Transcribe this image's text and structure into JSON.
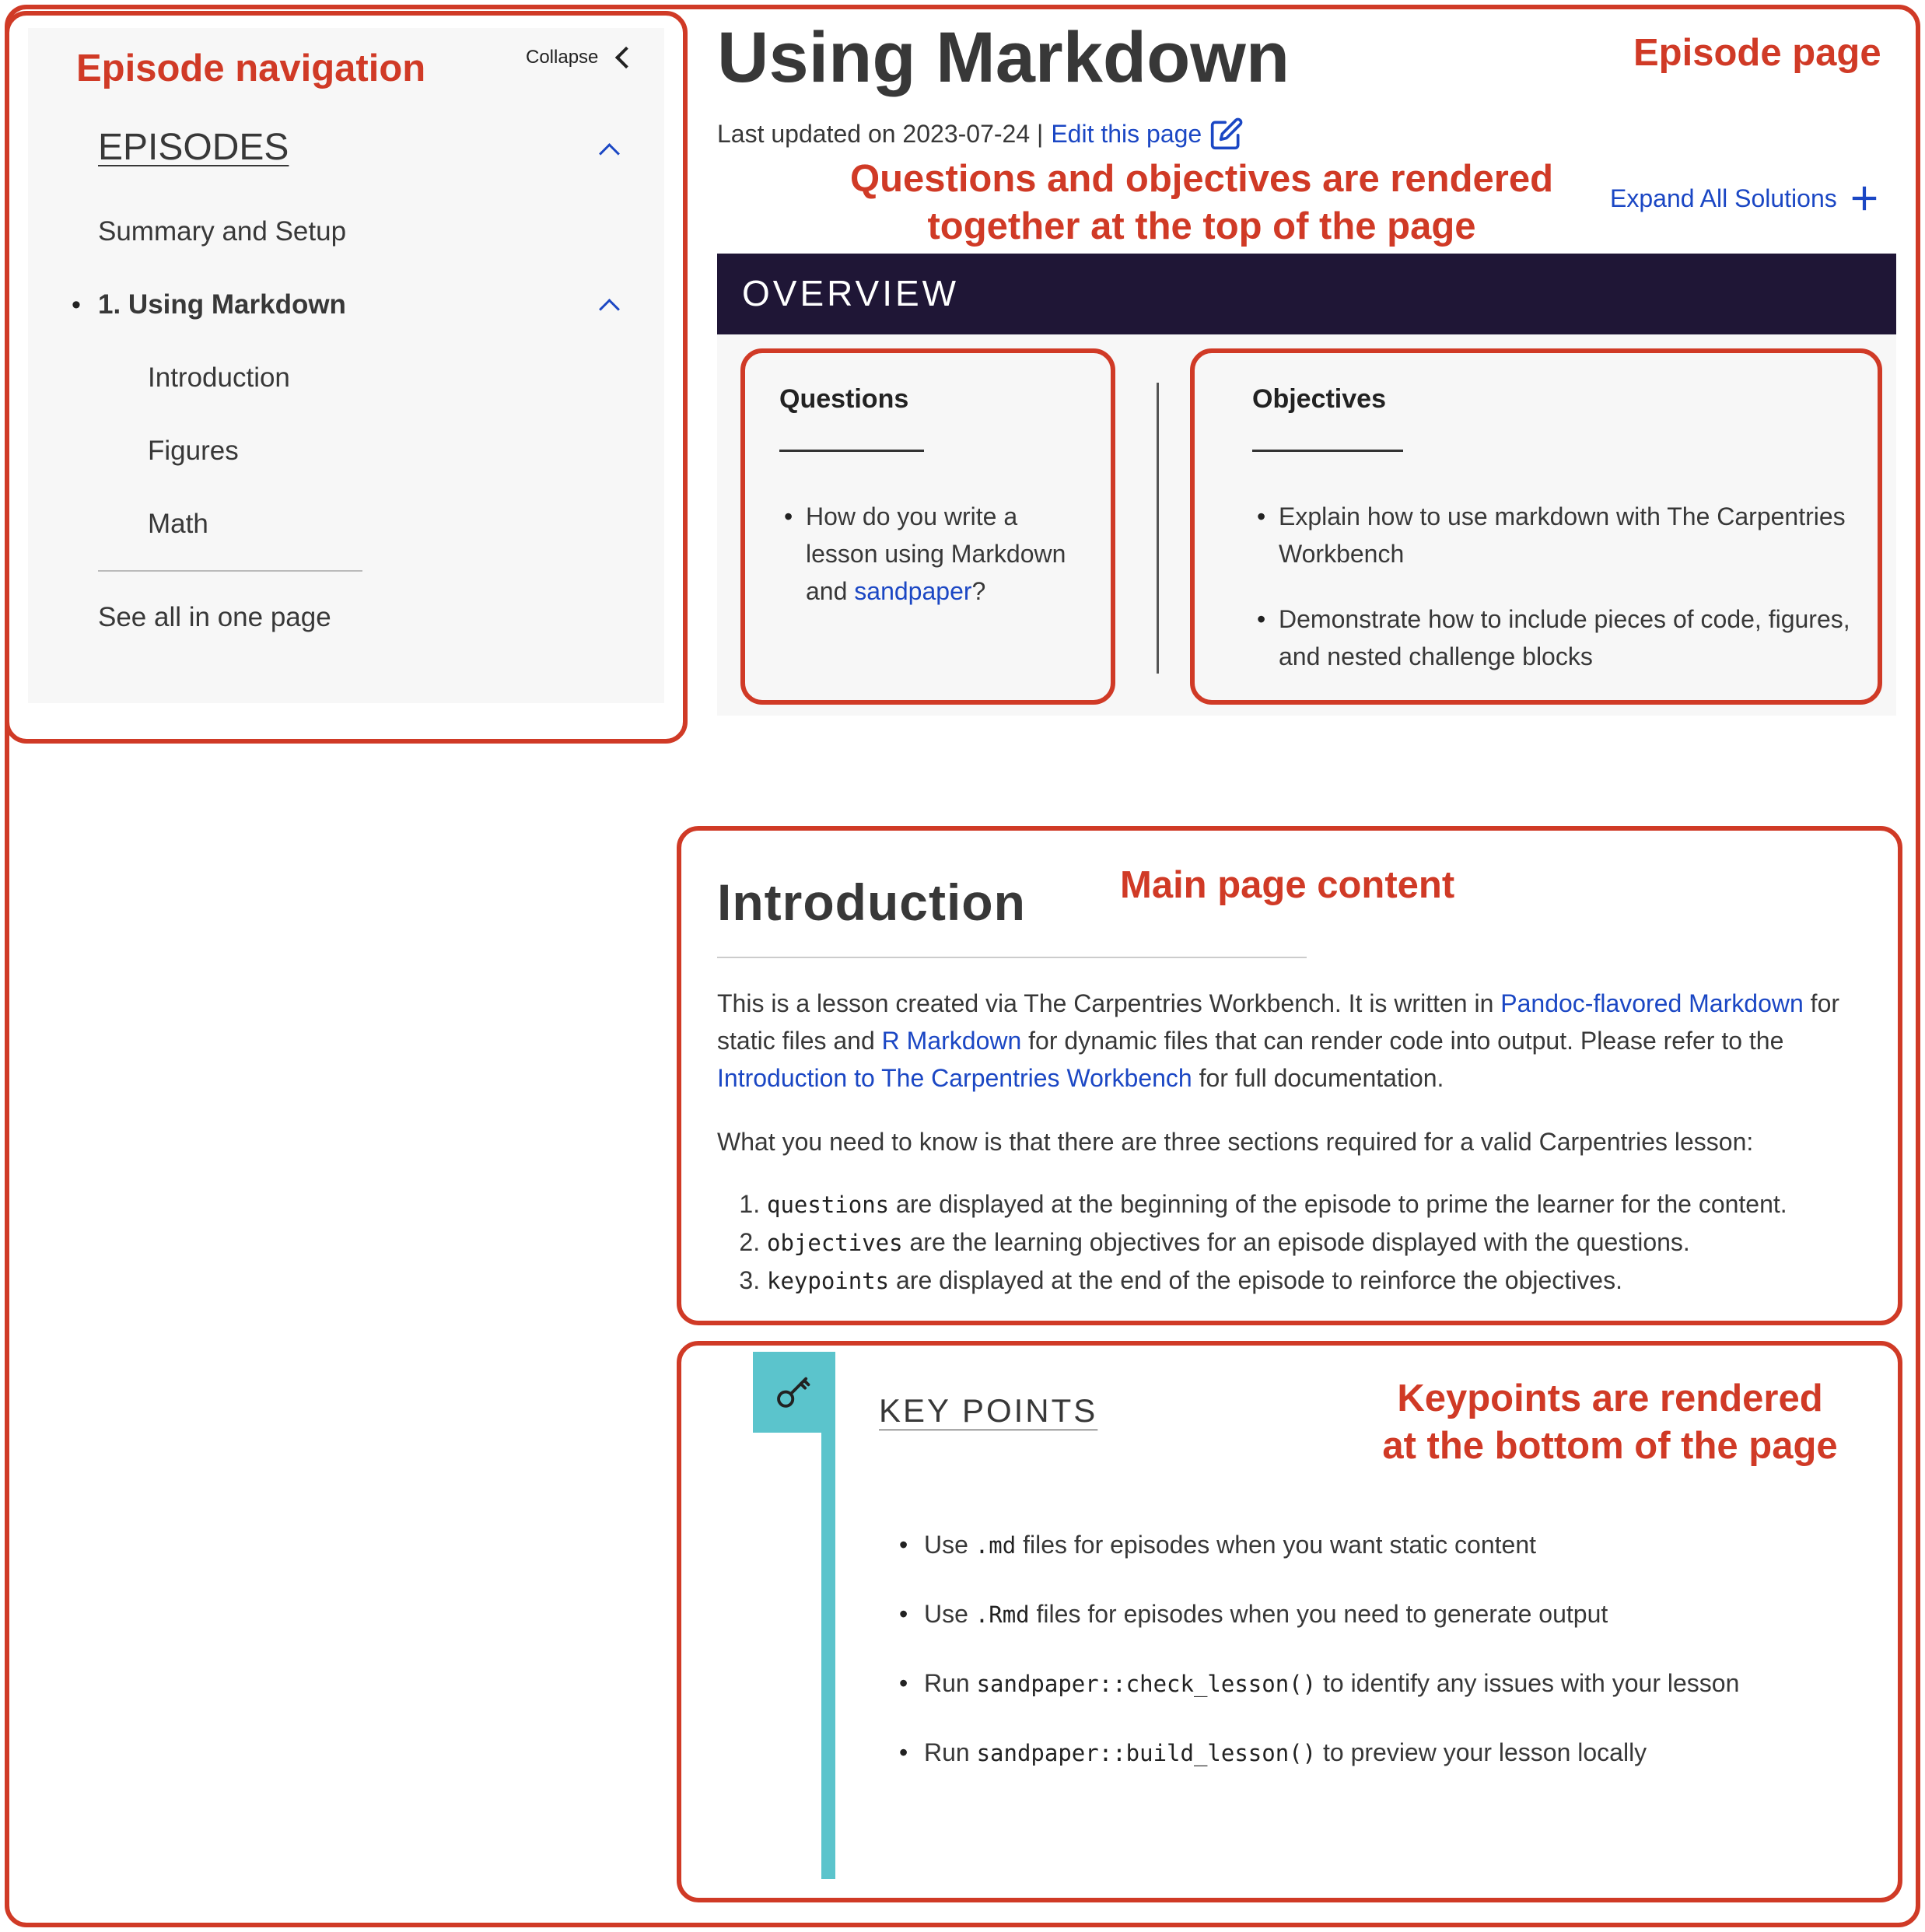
{
  "annotations": {
    "episode_navigation": "Episode navigation",
    "episode_page": "Episode page",
    "questions_objectives_line1": "Questions and objectives are rendered",
    "questions_objectives_line2": "together at the top of the page",
    "main_content": "Main page content",
    "keypoints_line1": "Keypoints are rendered",
    "keypoints_line2": "at the bottom of the page"
  },
  "sidebar": {
    "collapse_label": "Collapse",
    "episodes_heading": "EPISODES",
    "items": [
      {
        "label": "Summary and Setup"
      },
      {
        "label": "1. Using Markdown"
      }
    ],
    "subitems": [
      {
        "label": "Introduction"
      },
      {
        "label": "Figures"
      },
      {
        "label": "Math"
      }
    ],
    "see_all": "See all in one page"
  },
  "page": {
    "title": "Using Markdown",
    "last_updated": "Last updated on 2023-07-24 |",
    "edit_link": "Edit this page",
    "expand_all": "Expand All Solutions"
  },
  "overview": {
    "band_title": "OVERVIEW",
    "questions_title": "Questions",
    "question_text": "How do you write a lesson using Markdown and",
    "question_link": "sandpaper",
    "question_end": "?",
    "objectives_title": "Objectives",
    "objectives": [
      "Explain how to use markdown with The Carpentries Workbench",
      "Demonstrate how to include pieces of code, figures, and nested challenge blocks"
    ]
  },
  "intro": {
    "heading": "Introduction",
    "p1_a": "This is a lesson created via The Carpentries Workbench. It is written in",
    "p1_link1": "Pandoc-flavored Markdown",
    "p1_b": "for static files and",
    "p1_link2": "R Markdown",
    "p1_c": "for dynamic files that can render code into output. Please refer to the",
    "p1_link3": "Introduction to The Carpentries Workbench",
    "p1_d": "for full documentation.",
    "p2": "What you need to know is that there are three sections required for a valid Carpentries lesson:",
    "list": [
      {
        "code": "questions",
        "text": " are displayed at the beginning of the episode to prime the learner for the content."
      },
      {
        "code": "objectives",
        "text": " are the learning objectives for an episode displayed with the questions."
      },
      {
        "code": "keypoints",
        "text": " are displayed at the end of the episode to reinforce the objectives."
      }
    ]
  },
  "keypoints": {
    "heading": "KEY POINTS",
    "icon": "key-icon",
    "items": [
      {
        "pre": "Use ",
        "code": ".md",
        "post": " files for episodes when you want static content"
      },
      {
        "pre": "Use ",
        "code": ".Rmd",
        "post": " files for episodes when you need to generate output"
      },
      {
        "pre": "Run ",
        "code": "sandpaper::check_lesson()",
        "post": " to identify any issues with your lesson"
      },
      {
        "pre": "Run ",
        "code": "sandpaper::build_lesson()",
        "post": " to preview your lesson locally"
      }
    ]
  },
  "colors": {
    "annotation_red": "#d03a26",
    "link_blue": "#1b47c4",
    "overview_band": "#1f1636",
    "keypoint_teal": "#5bc4cc"
  }
}
